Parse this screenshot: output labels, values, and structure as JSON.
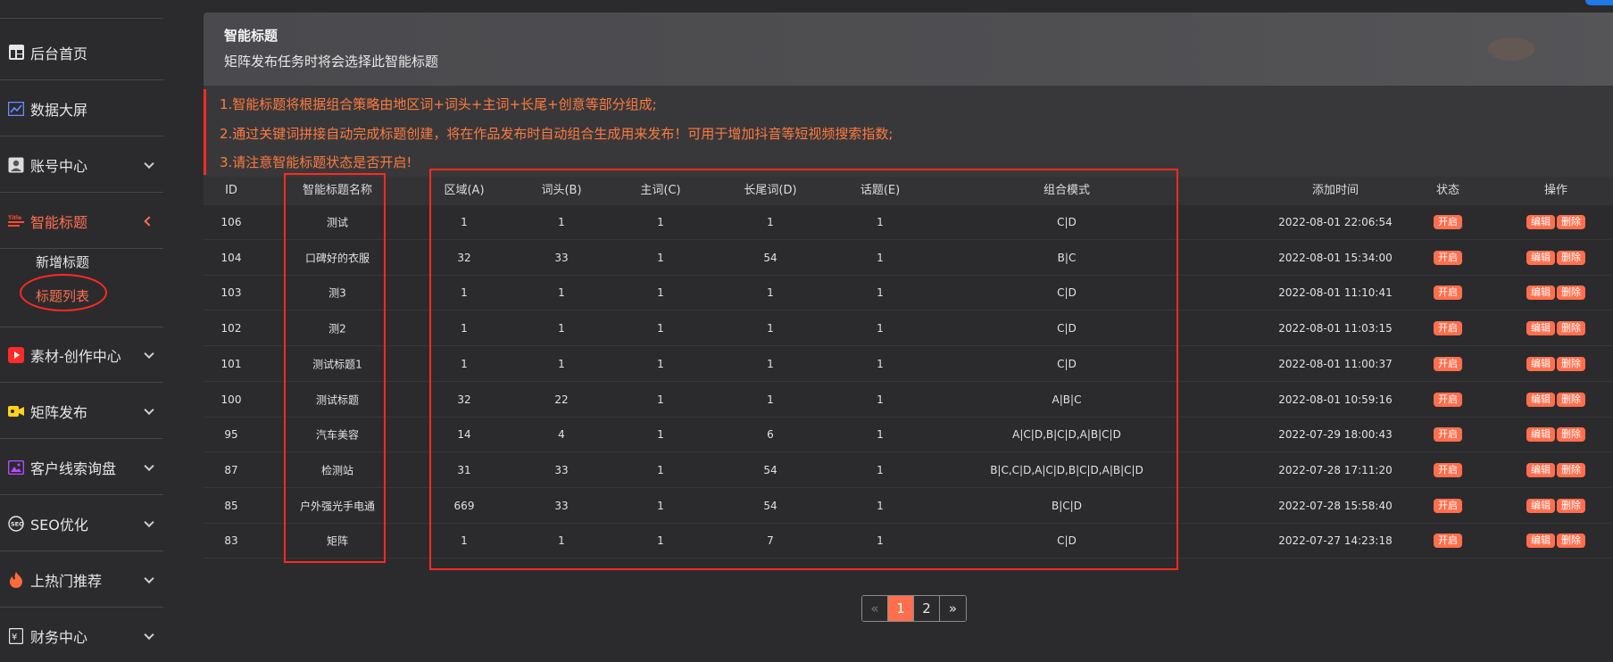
{
  "sidebar": {
    "items": [
      {
        "label": "后台首页",
        "icon": "dashboard-icon",
        "has_chevron": false
      },
      {
        "label": "数据大屏",
        "icon": "chart-line-icon",
        "has_chevron": false
      },
      {
        "label": "账号中心",
        "icon": "user-card-icon",
        "has_chevron": true
      },
      {
        "label": "智能标题",
        "icon": "title-icon",
        "has_chevron": true,
        "active": true
      },
      {
        "label": "素材-创作中心",
        "icon": "video-play-icon",
        "has_chevron": true
      },
      {
        "label": "矩阵发布",
        "icon": "video-camera-icon",
        "has_chevron": true
      },
      {
        "label": "客户线索询盘",
        "icon": "image-gallery-icon",
        "has_chevron": true
      },
      {
        "label": "SEO优化",
        "icon": "seo-icon",
        "has_chevron": true
      },
      {
        "label": "上热门推荐",
        "icon": "fire-icon",
        "has_chevron": true
      },
      {
        "label": "财务中心",
        "icon": "finance-icon",
        "has_chevron": true
      }
    ],
    "sub_items": [
      {
        "label": "新增标题",
        "current": false
      },
      {
        "label": "标题列表",
        "current": true
      }
    ]
  },
  "header": {
    "title": "智能标题",
    "subtitle": "矩阵发布任务时将会选择此智能标题"
  },
  "notice": {
    "lines": [
      "1.智能标题将根据组合策略由地区词+词头+主词+长尾+创意等部分组成;",
      "2.通过关键词拼接自动完成标题创建，将在作品发布时自动组合生成用来发布！可用于增加抖音等短视频搜索指数;",
      "3.请注意智能标题状态是否开启!"
    ]
  },
  "table": {
    "columns": [
      "ID",
      "智能标题名称",
      "区域(A)",
      "词头(B)",
      "主词(C)",
      "长尾词(D)",
      "话题(E)",
      "组合模式",
      "添加时间",
      "状态",
      "操作"
    ],
    "status_label": "开启",
    "edit_label": "编辑",
    "delete_label": "删除",
    "rows": [
      {
        "id": "106",
        "name": "测试",
        "a": "1",
        "b": "1",
        "c": "1",
        "d": "1",
        "e": "1",
        "mode": "C|D",
        "time": "2022-08-01 22:06:54"
      },
      {
        "id": "104",
        "name": "口碑好的衣服",
        "a": "32",
        "b": "33",
        "c": "1",
        "d": "54",
        "e": "1",
        "mode": "B|C",
        "time": "2022-08-01 15:34:00"
      },
      {
        "id": "103",
        "name": "测3",
        "a": "1",
        "b": "1",
        "c": "1",
        "d": "1",
        "e": "1",
        "mode": "C|D",
        "time": "2022-08-01 11:10:41"
      },
      {
        "id": "102",
        "name": "测2",
        "a": "1",
        "b": "1",
        "c": "1",
        "d": "1",
        "e": "1",
        "mode": "C|D",
        "time": "2022-08-01 11:03:15"
      },
      {
        "id": "101",
        "name": "测试标题1",
        "a": "1",
        "b": "1",
        "c": "1",
        "d": "1",
        "e": "1",
        "mode": "C|D",
        "time": "2022-08-01 11:00:37"
      },
      {
        "id": "100",
        "name": "测试标题",
        "a": "32",
        "b": "22",
        "c": "1",
        "d": "1",
        "e": "1",
        "mode": "A|B|C",
        "time": "2022-08-01 10:59:16"
      },
      {
        "id": "95",
        "name": "汽车美容",
        "a": "14",
        "b": "4",
        "c": "1",
        "d": "6",
        "e": "1",
        "mode": "A|C|D,B|C|D,A|B|C|D",
        "time": "2022-07-29 18:00:43"
      },
      {
        "id": "87",
        "name": "检测站",
        "a": "31",
        "b": "33",
        "c": "1",
        "d": "54",
        "e": "1",
        "mode": "B|C,C|D,A|C|D,B|C|D,A|B|C|D",
        "time": "2022-07-28 17:11:20"
      },
      {
        "id": "85",
        "name": "户外强光手电通",
        "a": "669",
        "b": "33",
        "c": "1",
        "d": "54",
        "e": "1",
        "mode": "B|C|D",
        "time": "2022-07-28 15:58:40"
      },
      {
        "id": "83",
        "name": "矩阵",
        "a": "1",
        "b": "1",
        "c": "1",
        "d": "7",
        "e": "1",
        "mode": "C|D",
        "time": "2022-07-27 14:23:18"
      }
    ]
  },
  "pagination": {
    "prev": "«",
    "pages": [
      "1",
      "2"
    ],
    "current": "1",
    "next": "»"
  },
  "colors": {
    "accent": "#ff6f4e",
    "annotation_red": "#ff2a1e",
    "notice_text": "#ff7a3d",
    "background": "#2b2b2e"
  }
}
